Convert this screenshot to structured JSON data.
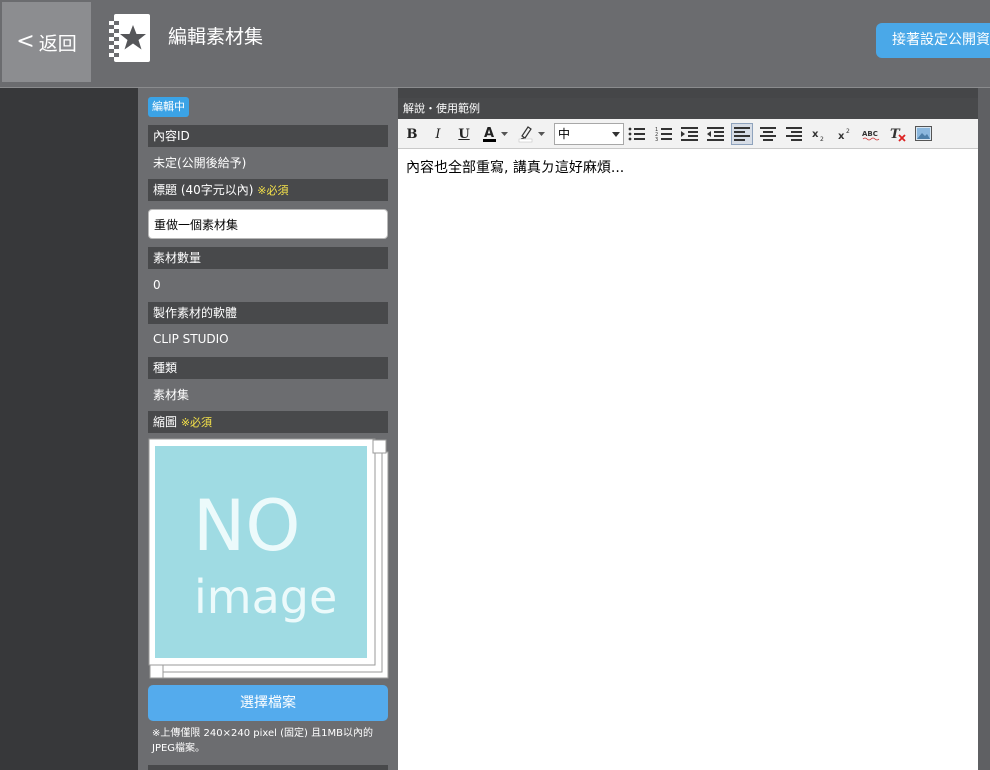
{
  "header": {
    "back_label": "返回",
    "title": "編輯素材集",
    "publish_label": "接著設定公開資"
  },
  "form": {
    "status_badge": "編輯中",
    "content_id": {
      "label": "內容ID",
      "value": "未定(公開後給予)"
    },
    "title_field": {
      "label": "標題 (40字元以內)",
      "required": "※必須",
      "value": "重做一個素材集"
    },
    "item_count": {
      "label": "素材數量",
      "value": "0"
    },
    "software": {
      "label": "製作素材的軟體",
      "value": "CLIP STUDIO"
    },
    "category": {
      "label": "種類",
      "value": "素材集"
    },
    "thumbnail": {
      "label": "縮圖",
      "required": "※必須",
      "placeholder_top": "NO",
      "placeholder_bottom": "image"
    },
    "choose_file_label": "選擇檔案",
    "upload_note": "※上傳僅限 240×240 pixel (固定) 且1MB以內的JPEG檔案。"
  },
  "editor": {
    "label": "解說・使用範例",
    "font_size_value": "中",
    "content": "內容也全部重寫, 講真ㄉ這好麻煩..."
  },
  "colors": {
    "accent": "#3ba3e6",
    "button": "#54abed",
    "required": "#f5e24a",
    "thumb_bg": "#9fdbe3"
  }
}
